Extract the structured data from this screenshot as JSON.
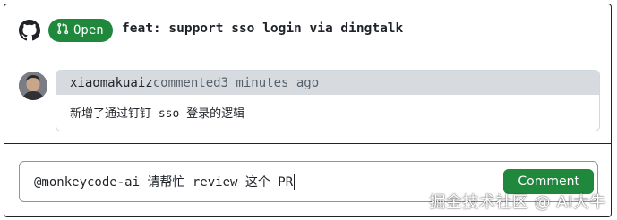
{
  "header": {
    "logo_icon": "github-mark-icon",
    "state_icon": "git-pull-request-icon",
    "state_label": "Open",
    "title": "feat: support sso login via dingtalk"
  },
  "timeline": {
    "comment": {
      "author": "xiaomakuaiz",
      "action": "commented",
      "time": "3 minutes ago",
      "body": "新增了通过钉钉 sso 登录的逻辑"
    }
  },
  "composer": {
    "value": "@monkeycode-ai 请帮忙 review 这个 PR",
    "submit_label": "Comment"
  },
  "watermark": "掘金技术社区 @ AI大牛",
  "colors": {
    "accent_green": "#1f883d",
    "border_dark": "#1f2328",
    "comment_header_bg": "#d7dbe0"
  }
}
